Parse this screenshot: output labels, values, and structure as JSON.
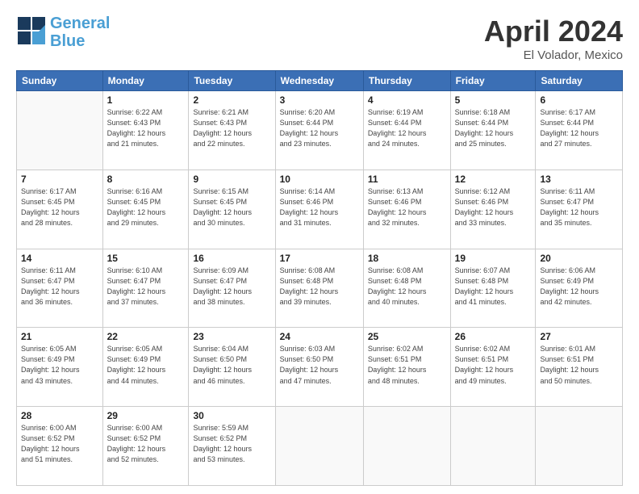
{
  "logo": {
    "line1": "General",
    "line2": "Blue"
  },
  "title": "April 2024",
  "subtitle": "El Volador, Mexico",
  "header_days": [
    "Sunday",
    "Monday",
    "Tuesday",
    "Wednesday",
    "Thursday",
    "Friday",
    "Saturday"
  ],
  "weeks": [
    [
      {
        "num": "",
        "empty": true
      },
      {
        "num": "1",
        "sunrise": "6:22 AM",
        "sunset": "6:43 PM",
        "daylight": "12 hours and 21 minutes."
      },
      {
        "num": "2",
        "sunrise": "6:21 AM",
        "sunset": "6:43 PM",
        "daylight": "12 hours and 22 minutes."
      },
      {
        "num": "3",
        "sunrise": "6:20 AM",
        "sunset": "6:44 PM",
        "daylight": "12 hours and 23 minutes."
      },
      {
        "num": "4",
        "sunrise": "6:19 AM",
        "sunset": "6:44 PM",
        "daylight": "12 hours and 24 minutes."
      },
      {
        "num": "5",
        "sunrise": "6:18 AM",
        "sunset": "6:44 PM",
        "daylight": "12 hours and 25 minutes."
      },
      {
        "num": "6",
        "sunrise": "6:17 AM",
        "sunset": "6:44 PM",
        "daylight": "12 hours and 27 minutes."
      }
    ],
    [
      {
        "num": "7",
        "sunrise": "6:17 AM",
        "sunset": "6:45 PM",
        "daylight": "12 hours and 28 minutes."
      },
      {
        "num": "8",
        "sunrise": "6:16 AM",
        "sunset": "6:45 PM",
        "daylight": "12 hours and 29 minutes."
      },
      {
        "num": "9",
        "sunrise": "6:15 AM",
        "sunset": "6:45 PM",
        "daylight": "12 hours and 30 minutes."
      },
      {
        "num": "10",
        "sunrise": "6:14 AM",
        "sunset": "6:46 PM",
        "daylight": "12 hours and 31 minutes."
      },
      {
        "num": "11",
        "sunrise": "6:13 AM",
        "sunset": "6:46 PM",
        "daylight": "12 hours and 32 minutes."
      },
      {
        "num": "12",
        "sunrise": "6:12 AM",
        "sunset": "6:46 PM",
        "daylight": "12 hours and 33 minutes."
      },
      {
        "num": "13",
        "sunrise": "6:11 AM",
        "sunset": "6:47 PM",
        "daylight": "12 hours and 35 minutes."
      }
    ],
    [
      {
        "num": "14",
        "sunrise": "6:11 AM",
        "sunset": "6:47 PM",
        "daylight": "12 hours and 36 minutes."
      },
      {
        "num": "15",
        "sunrise": "6:10 AM",
        "sunset": "6:47 PM",
        "daylight": "12 hours and 37 minutes."
      },
      {
        "num": "16",
        "sunrise": "6:09 AM",
        "sunset": "6:47 PM",
        "daylight": "12 hours and 38 minutes."
      },
      {
        "num": "17",
        "sunrise": "6:08 AM",
        "sunset": "6:48 PM",
        "daylight": "12 hours and 39 minutes."
      },
      {
        "num": "18",
        "sunrise": "6:08 AM",
        "sunset": "6:48 PM",
        "daylight": "12 hours and 40 minutes."
      },
      {
        "num": "19",
        "sunrise": "6:07 AM",
        "sunset": "6:48 PM",
        "daylight": "12 hours and 41 minutes."
      },
      {
        "num": "20",
        "sunrise": "6:06 AM",
        "sunset": "6:49 PM",
        "daylight": "12 hours and 42 minutes."
      }
    ],
    [
      {
        "num": "21",
        "sunrise": "6:05 AM",
        "sunset": "6:49 PM",
        "daylight": "12 hours and 43 minutes."
      },
      {
        "num": "22",
        "sunrise": "6:05 AM",
        "sunset": "6:49 PM",
        "daylight": "12 hours and 44 minutes."
      },
      {
        "num": "23",
        "sunrise": "6:04 AM",
        "sunset": "6:50 PM",
        "daylight": "12 hours and 46 minutes."
      },
      {
        "num": "24",
        "sunrise": "6:03 AM",
        "sunset": "6:50 PM",
        "daylight": "12 hours and 47 minutes."
      },
      {
        "num": "25",
        "sunrise": "6:02 AM",
        "sunset": "6:51 PM",
        "daylight": "12 hours and 48 minutes."
      },
      {
        "num": "26",
        "sunrise": "6:02 AM",
        "sunset": "6:51 PM",
        "daylight": "12 hours and 49 minutes."
      },
      {
        "num": "27",
        "sunrise": "6:01 AM",
        "sunset": "6:51 PM",
        "daylight": "12 hours and 50 minutes."
      }
    ],
    [
      {
        "num": "28",
        "sunrise": "6:00 AM",
        "sunset": "6:52 PM",
        "daylight": "12 hours and 51 minutes."
      },
      {
        "num": "29",
        "sunrise": "6:00 AM",
        "sunset": "6:52 PM",
        "daylight": "12 hours and 52 minutes."
      },
      {
        "num": "30",
        "sunrise": "5:59 AM",
        "sunset": "6:52 PM",
        "daylight": "12 hours and 53 minutes."
      },
      {
        "num": "",
        "empty": true
      },
      {
        "num": "",
        "empty": true
      },
      {
        "num": "",
        "empty": true
      },
      {
        "num": "",
        "empty": true
      }
    ]
  ]
}
